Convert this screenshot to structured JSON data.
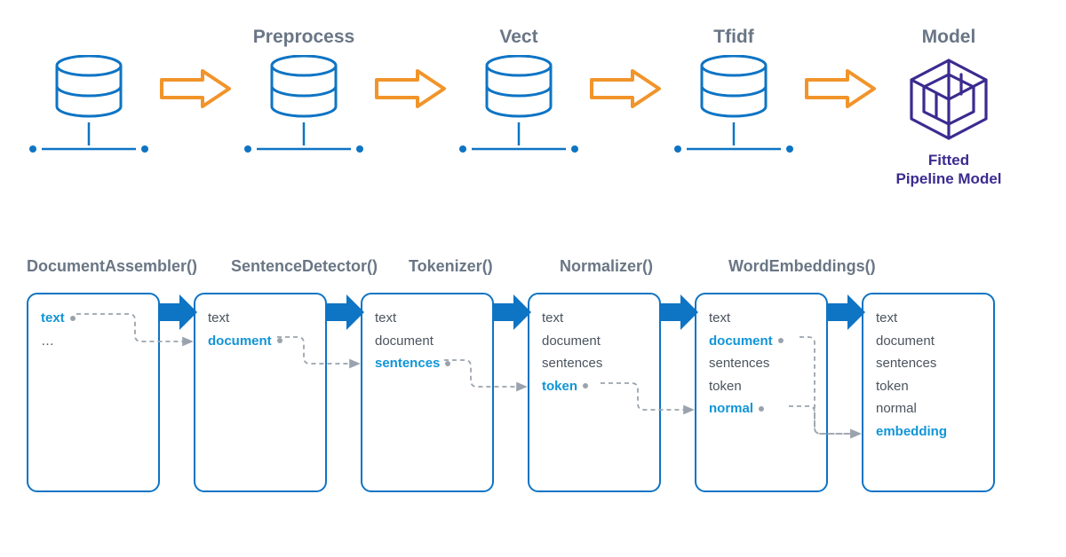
{
  "topPipeline": {
    "steps": [
      {
        "label": ""
      },
      {
        "label": "Preprocess"
      },
      {
        "label": "Vect"
      },
      {
        "label": "Tfidf"
      },
      {
        "label": "Model"
      }
    ],
    "result": {
      "caption": "Fitted\nPipeline Model"
    }
  },
  "bottomPipeline": {
    "stages": [
      {
        "title": "DocumentAssembler()",
        "columns": [
          {
            "text": "text",
            "active": true,
            "hasDot": true
          },
          {
            "text": "…",
            "active": false,
            "hasDot": false
          }
        ]
      },
      {
        "title": "SentenceDetector()",
        "columns": [
          {
            "text": "text",
            "active": false,
            "hasDot": false
          },
          {
            "text": "document",
            "active": true,
            "hasDot": true
          }
        ]
      },
      {
        "title": "Tokenizer()",
        "columns": [
          {
            "text": "text",
            "active": false,
            "hasDot": false
          },
          {
            "text": "document",
            "active": false,
            "hasDot": false
          },
          {
            "text": "sentences",
            "active": true,
            "hasDot": true
          }
        ]
      },
      {
        "title": "Normalizer()",
        "columns": [
          {
            "text": "text",
            "active": false,
            "hasDot": false
          },
          {
            "text": "document",
            "active": false,
            "hasDot": false
          },
          {
            "text": "sentences",
            "active": false,
            "hasDot": false
          },
          {
            "text": "token",
            "active": true,
            "hasDot": true
          }
        ]
      },
      {
        "title": "WordEmbeddings()",
        "columns": [
          {
            "text": "text",
            "active": false,
            "hasDot": false
          },
          {
            "text": "document",
            "active": true,
            "hasDot": true
          },
          {
            "text": "sentences",
            "active": false,
            "hasDot": false
          },
          {
            "text": "token",
            "active": false,
            "hasDot": false
          },
          {
            "text": "normal",
            "active": true,
            "hasDot": true
          }
        ]
      },
      {
        "title": "",
        "columns": [
          {
            "text": "text",
            "active": false,
            "hasDot": false
          },
          {
            "text": "document",
            "active": false,
            "hasDot": false
          },
          {
            "text": "sentences",
            "active": false,
            "hasDot": false
          },
          {
            "text": "token",
            "active": false,
            "hasDot": false
          },
          {
            "text": "normal",
            "active": false,
            "hasDot": false
          },
          {
            "text": "embedding",
            "active": true,
            "hasDot": false
          }
        ]
      }
    ]
  },
  "colors": {
    "blue": "#0e74c4",
    "orange": "#f1942a",
    "purple": "#3b2b90",
    "gray": "#6a7685"
  }
}
